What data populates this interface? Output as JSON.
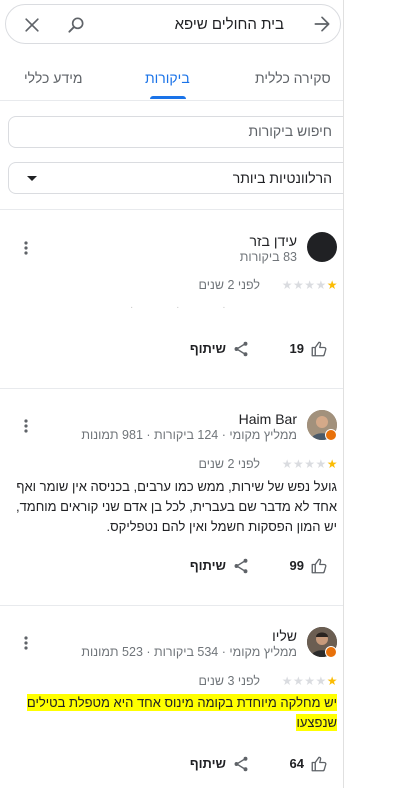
{
  "search": {
    "query": "בית החולים שיפא"
  },
  "tabs": [
    {
      "label": "סקירה כללית",
      "active": false
    },
    {
      "label": "ביקורות",
      "active": true
    },
    {
      "label": "מידע כללי",
      "active": false
    }
  ],
  "reviews_search": {
    "placeholder": "חיפוש ביקורות"
  },
  "sort": {
    "selected": "הרלוונטיות ביותר"
  },
  "colors": {
    "accent": "#1a73e8",
    "star": "#fbbc04",
    "highlight": "#ffff00",
    "guide_badge": "#e8710a"
  },
  "reviews": [
    {
      "name": "עידן בזר",
      "meta": "83 ביקורות",
      "rating": 1,
      "date": "לפני 2 שנים",
      "text": "",
      "likes": "19",
      "share": "שיתוף",
      "avatar": "dark-circle",
      "local_guide": false
    },
    {
      "name": "Haim Bar",
      "meta": "ממליץ מקומי · 124 ביקורות · 981 תמונות",
      "rating": 1,
      "date": "לפני 2 שנים",
      "text": "גועל נפש של שירות, ממש כמו ערבים, בכניסה אין שומר ואף אחד לא מדבר שם בעברית, לכל בן אדם שני קוראים מוחמד, יש המון הפסקות חשמל ואין להם נטפליקס.",
      "likes": "99",
      "share": "שיתוף",
      "avatar": "photo",
      "local_guide": true
    },
    {
      "name": "שליו",
      "meta": "ממליץ מקומי · 534 ביקורות · 523 תמונות",
      "rating": 1,
      "date": "לפני 3 שנים",
      "text_line1": "יש מחלקה מיוחדת בקומה מינוס אחד היא מטפלת בטילים",
      "text_line2": "שנפצעו",
      "likes": "64",
      "share": "שיתוף",
      "avatar": "photo",
      "local_guide": true
    }
  ]
}
